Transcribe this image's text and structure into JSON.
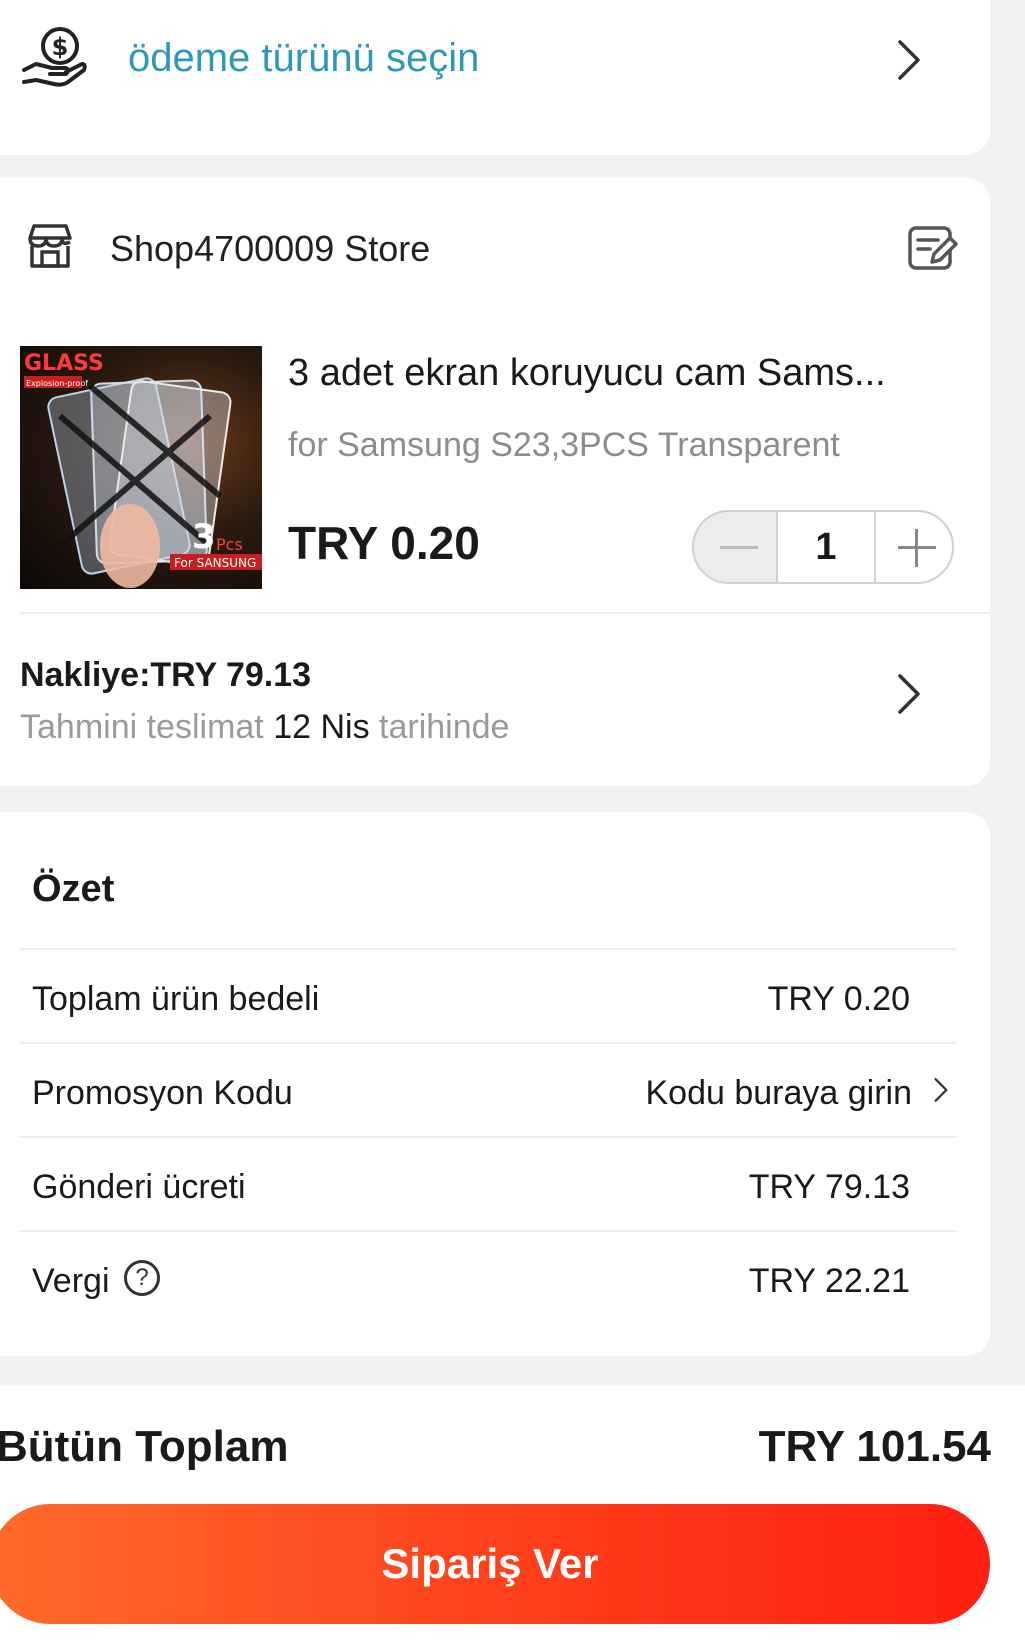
{
  "payment": {
    "label": "ödeme türünü seçin"
  },
  "store": {
    "name": "Shop4700009 Store",
    "product": {
      "title": "3 adet ekran koruyucu cam Sams...",
      "variant": "for Samsung S23,3PCS Transparent",
      "price": "TRY 0.20",
      "quantity": "1",
      "image_text": {
        "brand": "GLASS",
        "sub": "Explosion-proof",
        "count": "3",
        "pcs": "Pcs",
        "for": "For SANSUNG"
      }
    },
    "shipping": {
      "label": "Nakliye:TRY 79.13",
      "eta_prefix": "Tahmini teslimat",
      "eta_date": "12 Nis",
      "eta_suffix": "tarihinde"
    }
  },
  "summary": {
    "title": "Özet",
    "rows": [
      {
        "label": "Toplam ürün bedeli",
        "value": "TRY 0.20"
      },
      {
        "label": "Promosyon Kodu",
        "value": "Kodu buraya girin"
      },
      {
        "label": "Gönderi ücreti",
        "value": "TRY 79.13"
      },
      {
        "label": "Vergi",
        "value": "TRY 22.21"
      }
    ]
  },
  "footer": {
    "total_label": "Bütün Toplam",
    "total_value": "TRY 101.54",
    "order_button": "Sipariş Ver"
  },
  "colors": {
    "accent": "#2f97b8",
    "button_start": "#ff6a2a",
    "button_end": "#ff1f12"
  }
}
